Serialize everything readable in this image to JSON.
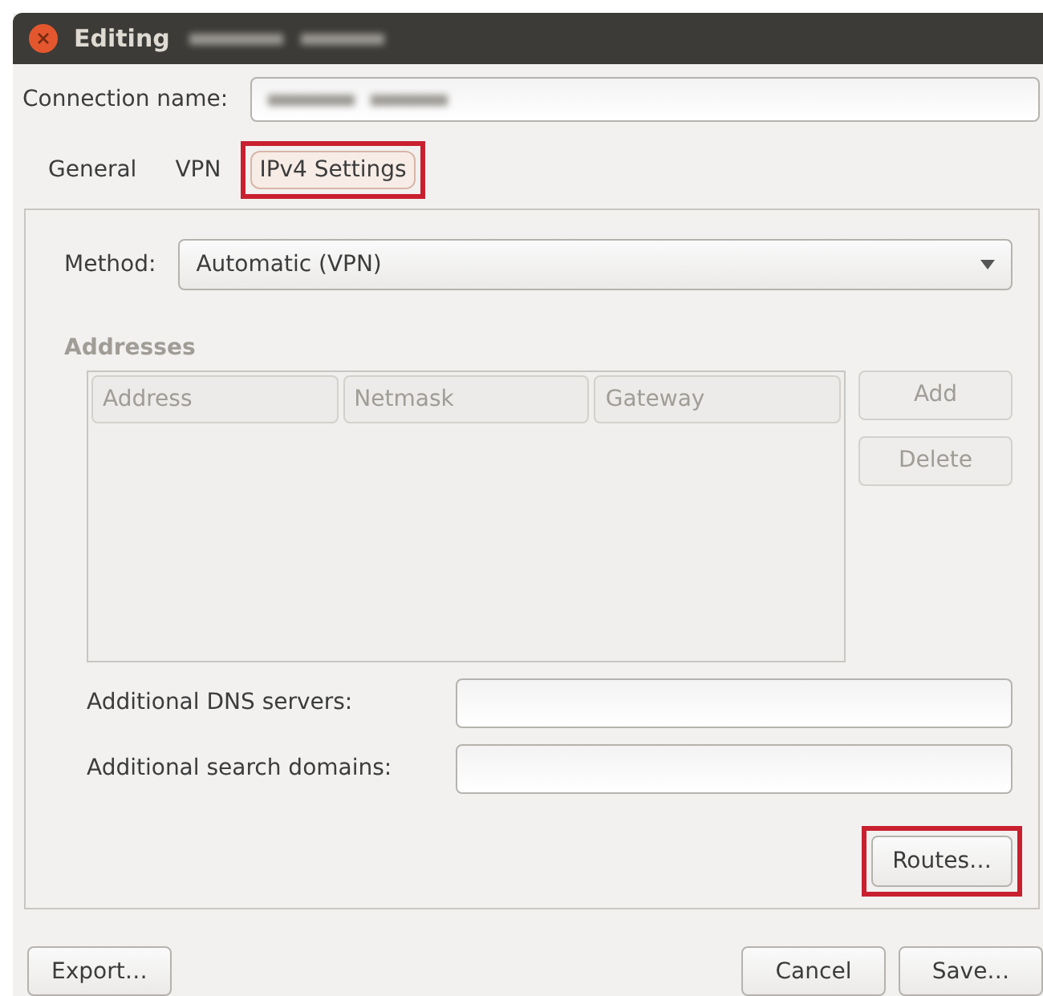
{
  "window": {
    "title": "Editing",
    "title_blurred": true
  },
  "connection_name": {
    "label": "Connection name:",
    "value_blurred": true
  },
  "tabs": [
    {
      "label": "General",
      "selected": false,
      "highlighted": false
    },
    {
      "label": "VPN",
      "selected": false,
      "highlighted": false
    },
    {
      "label": "IPv4 Settings",
      "selected": true,
      "highlighted": true
    }
  ],
  "method": {
    "label": "Method:",
    "value": "Automatic (VPN)"
  },
  "addresses": {
    "heading": "Addresses",
    "columns": [
      "Address",
      "Netmask",
      "Gateway"
    ],
    "buttons": [
      {
        "label": "Add",
        "disabled": true
      },
      {
        "label": "Delete",
        "disabled": true
      }
    ]
  },
  "fields": [
    {
      "label": "Additional DNS servers:"
    },
    {
      "label": "Additional search domains:"
    }
  ],
  "routes_button": {
    "label": "Routes…",
    "highlighted": true
  },
  "footer": {
    "left": [
      {
        "label": "Export…"
      }
    ],
    "right": [
      {
        "label": "Cancel"
      },
      {
        "label": "Save…"
      }
    ]
  }
}
